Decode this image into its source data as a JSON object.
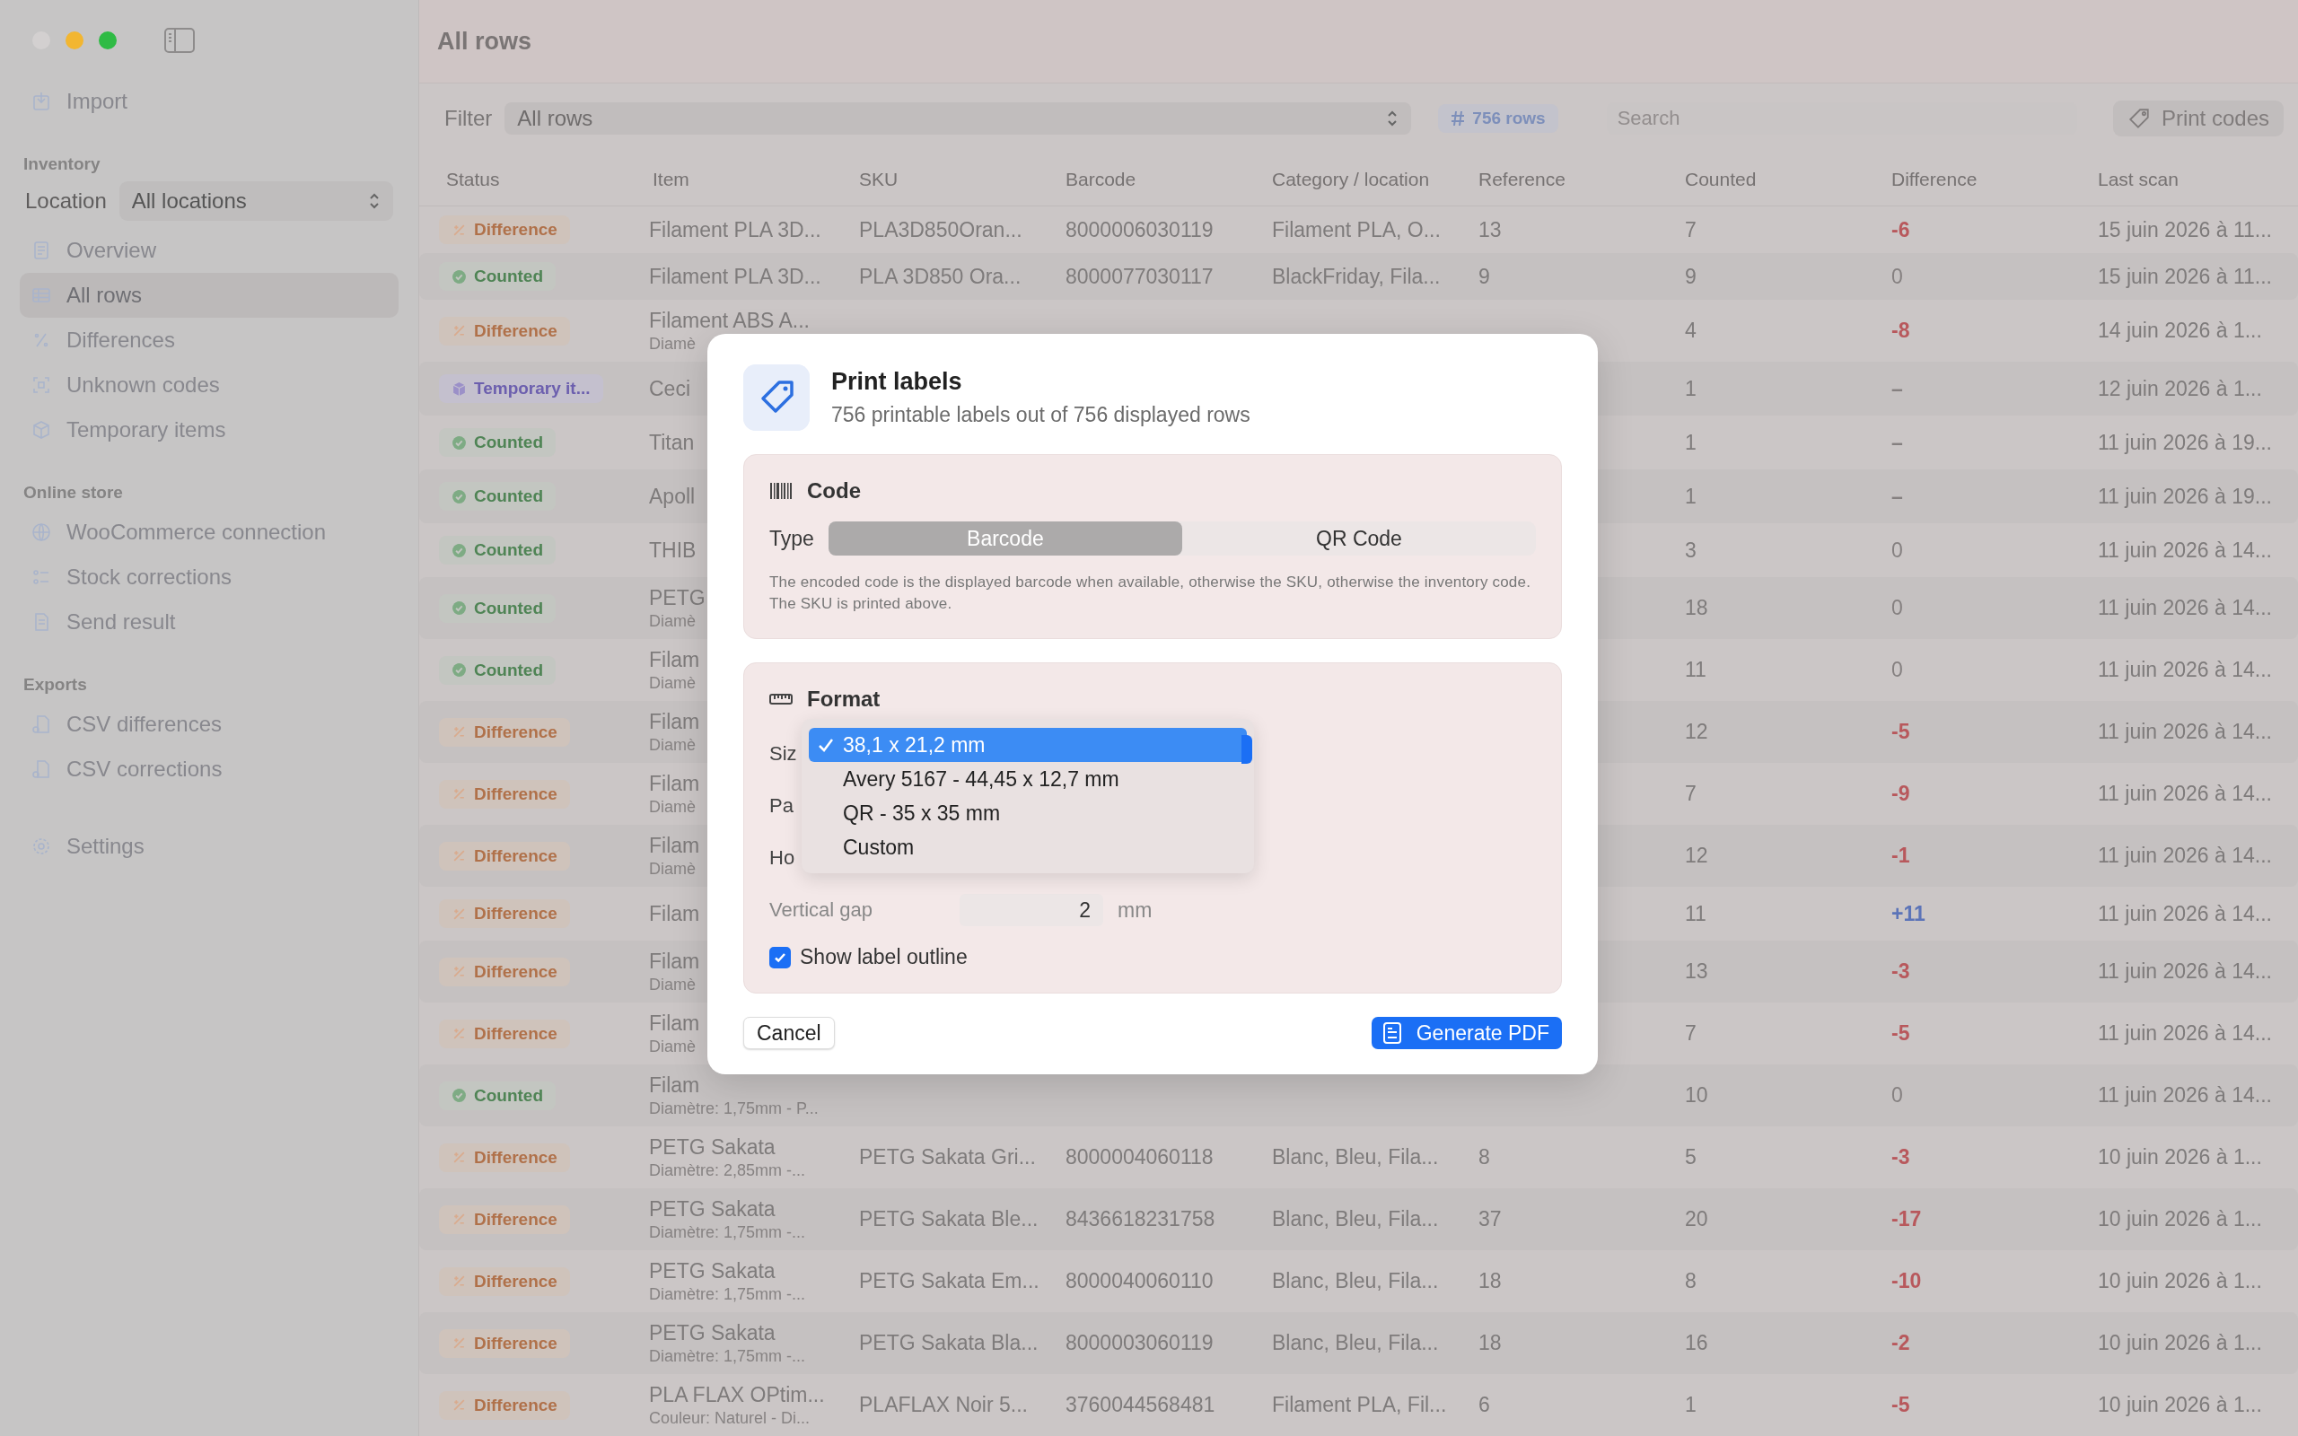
{
  "window": {
    "title": "All rows"
  },
  "sidebar": {
    "sections": [
      {
        "items": [
          {
            "label": "Import",
            "selected": false
          }
        ]
      },
      {
        "title": "Inventory",
        "location": {
          "label": "Location",
          "value": "All locations"
        },
        "items": [
          {
            "label": "Overview",
            "selected": false
          },
          {
            "label": "All rows",
            "selected": true
          },
          {
            "label": "Differences",
            "selected": false
          },
          {
            "label": "Unknown codes",
            "selected": false
          },
          {
            "label": "Temporary items",
            "selected": false
          }
        ]
      },
      {
        "title": "Online store",
        "items": [
          {
            "label": "WooCommerce connection",
            "selected": false
          },
          {
            "label": "Stock corrections",
            "selected": false
          },
          {
            "label": "Send result",
            "selected": false
          }
        ]
      },
      {
        "title": "Exports",
        "items": [
          {
            "label": "CSV differences",
            "selected": false
          },
          {
            "label": "CSV corrections",
            "selected": false
          }
        ]
      },
      {
        "items": [
          {
            "label": "Settings",
            "selected": false
          }
        ]
      }
    ]
  },
  "toolbar": {
    "filter_label": "Filter",
    "filter_value": "All rows",
    "row_count": "756 rows",
    "search": {
      "placeholder": "Search"
    },
    "print_button": "Print codes"
  },
  "table": {
    "columns": [
      "Status",
      "Item",
      "SKU",
      "Barcode",
      "Category / location",
      "Reference",
      "Counted",
      "Difference",
      "Last scan"
    ],
    "rows": [
      {
        "status": {
          "kind": "difference",
          "label": "Difference"
        },
        "item": "Filament PLA 3D...",
        "sku": "PLA3D850Oran...",
        "barcode": "8000006030119",
        "category": "Filament PLA, O...",
        "reference": "13",
        "counted": "7",
        "difference": {
          "kind": "negative",
          "value": "-6"
        },
        "last_scan": "15 juin 2026 à 11..."
      },
      {
        "status": {
          "kind": "counted",
          "label": "Counted"
        },
        "item": "Filament PLA 3D...",
        "sku": "PLA 3D850 Ora...",
        "barcode": "8000077030117",
        "category": "BlackFriday, Fila...",
        "reference": "9",
        "counted": "9",
        "difference": {
          "kind": "zero",
          "value": "0"
        },
        "last_scan": "15 juin 2026 à 11..."
      },
      {
        "status": {
          "kind": "difference",
          "label": "Difference"
        },
        "item": "Filament ABS A...",
        "subtitle": "Diamè",
        "counted": "4",
        "difference": {
          "kind": "negative",
          "value": "-8"
        },
        "last_scan": "14 juin 2026 à 1..."
      },
      {
        "status": {
          "kind": "temporary",
          "label": "Temporary it..."
        },
        "item": "Ceci",
        "counted": "1",
        "difference": {
          "kind": "none",
          "value": "–"
        },
        "last_scan": "12 juin 2026 à 1..."
      },
      {
        "status": {
          "kind": "counted",
          "label": "Counted"
        },
        "item": "Titan",
        "counted": "1",
        "difference": {
          "kind": "none",
          "value": "–"
        },
        "last_scan": "11 juin 2026 à 19..."
      },
      {
        "status": {
          "kind": "counted",
          "label": "Counted"
        },
        "item": "Apoll",
        "counted": "1",
        "difference": {
          "kind": "none",
          "value": "–"
        },
        "last_scan": "11 juin 2026 à 19..."
      },
      {
        "status": {
          "kind": "counted",
          "label": "Counted"
        },
        "item": "THIB",
        "counted": "3",
        "difference": {
          "kind": "zero",
          "value": "0"
        },
        "last_scan": "11 juin 2026 à 14..."
      },
      {
        "status": {
          "kind": "counted",
          "label": "Counted"
        },
        "item": "PETG",
        "subtitle": "Diamè",
        "counted": "18",
        "difference": {
          "kind": "zero",
          "value": "0"
        },
        "last_scan": "11 juin 2026 à 14..."
      },
      {
        "status": {
          "kind": "counted",
          "label": "Counted"
        },
        "item": "Filam",
        "subtitle": "Diamè",
        "counted": "11",
        "difference": {
          "kind": "zero",
          "value": "0"
        },
        "last_scan": "11 juin 2026 à 14..."
      },
      {
        "status": {
          "kind": "difference",
          "label": "Difference"
        },
        "item": "Filam",
        "subtitle": "Diamè",
        "counted": "12",
        "difference": {
          "kind": "negative",
          "value": "-5"
        },
        "last_scan": "11 juin 2026 à 14..."
      },
      {
        "status": {
          "kind": "difference",
          "label": "Difference"
        },
        "item": "Filam",
        "subtitle": "Diamè",
        "counted": "7",
        "difference": {
          "kind": "negative",
          "value": "-9"
        },
        "last_scan": "11 juin 2026 à 14..."
      },
      {
        "status": {
          "kind": "difference",
          "label": "Difference"
        },
        "item": "Filam",
        "subtitle": "Diamè",
        "counted": "12",
        "difference": {
          "kind": "negative",
          "value": "-1"
        },
        "last_scan": "11 juin 2026 à 14..."
      },
      {
        "status": {
          "kind": "difference",
          "label": "Difference"
        },
        "item": "Filam",
        "counted": "11",
        "difference": {
          "kind": "positive",
          "value": "+11"
        },
        "last_scan": "11 juin 2026 à 14..."
      },
      {
        "status": {
          "kind": "difference",
          "label": "Difference"
        },
        "item": "Filam",
        "subtitle": "Diamè",
        "counted": "13",
        "difference": {
          "kind": "negative",
          "value": "-3"
        },
        "last_scan": "11 juin 2026 à 14..."
      },
      {
        "status": {
          "kind": "difference",
          "label": "Difference"
        },
        "item": "Filam",
        "subtitle": "Diamè",
        "counted": "7",
        "difference": {
          "kind": "negative",
          "value": "-5"
        },
        "last_scan": "11 juin 2026 à 14..."
      },
      {
        "status": {
          "kind": "counted",
          "label": "Counted"
        },
        "item": "Filam",
        "subtitle": "Diamètre: 1,75mm - P...",
        "counted": "10",
        "difference": {
          "kind": "zero",
          "value": "0"
        },
        "last_scan": "11 juin 2026 à 14..."
      },
      {
        "status": {
          "kind": "difference",
          "label": "Difference"
        },
        "item": "PETG Sakata",
        "subtitle": "Diamètre: 2,85mm -...",
        "sku": "PETG Sakata Gri...",
        "barcode": "8000004060118",
        "category": "Blanc, Bleu, Fila...",
        "reference": "8",
        "counted": "5",
        "difference": {
          "kind": "negative",
          "value": "-3"
        },
        "last_scan": "10 juin 2026 à 1..."
      },
      {
        "status": {
          "kind": "difference",
          "label": "Difference"
        },
        "item": "PETG Sakata",
        "subtitle": "Diamètre: 1,75mm -...",
        "sku": "PETG Sakata Ble...",
        "barcode": "8436618231758",
        "category": "Blanc, Bleu, Fila...",
        "reference": "37",
        "counted": "20",
        "difference": {
          "kind": "negative",
          "value": "-17"
        },
        "last_scan": "10 juin 2026 à 1..."
      },
      {
        "status": {
          "kind": "difference",
          "label": "Difference"
        },
        "item": "PETG Sakata",
        "subtitle": "Diamètre: 1,75mm -...",
        "sku": "PETG Sakata Em...",
        "barcode": "8000040060110",
        "category": "Blanc, Bleu, Fila...",
        "reference": "18",
        "counted": "8",
        "difference": {
          "kind": "negative",
          "value": "-10"
        },
        "last_scan": "10 juin 2026 à 1..."
      },
      {
        "status": {
          "kind": "difference",
          "label": "Difference"
        },
        "item": "PETG Sakata",
        "subtitle": "Diamètre: 1,75mm -...",
        "sku": "PETG Sakata Bla...",
        "barcode": "8000003060119",
        "category": "Blanc, Bleu, Fila...",
        "reference": "18",
        "counted": "16",
        "difference": {
          "kind": "negative",
          "value": "-2"
        },
        "last_scan": "10 juin 2026 à 1..."
      },
      {
        "status": {
          "kind": "difference",
          "label": "Difference"
        },
        "item": "PLA FLAX OPtim...",
        "subtitle": "Couleur: Naturel - Di...",
        "sku": "PLAFLAX Noir 5...",
        "barcode": "3760044568481",
        "category": "Filament PLA, Fil...",
        "reference": "6",
        "counted": "1",
        "difference": {
          "kind": "negative",
          "value": "-5"
        },
        "last_scan": "10 juin 2026 à 1..."
      }
    ]
  },
  "dialog": {
    "title": "Print labels",
    "subtitle": "756 printable labels out of 756 displayed rows",
    "code_section": {
      "title": "Code",
      "type_label": "Type",
      "options": [
        {
          "label": "Barcode",
          "selected": true
        },
        {
          "label": "QR Code",
          "selected": false
        }
      ],
      "note": "The encoded code is the displayed barcode when available, otherwise the SKU, otherwise the inventory code. The SKU is printed above."
    },
    "format_section": {
      "title": "Format",
      "fields": [
        {
          "label": "Siz"
        },
        {
          "label": "Pa"
        },
        {
          "label": "Ho"
        },
        {
          "label": "Vertical gap",
          "value": "2",
          "unit": "mm"
        }
      ],
      "show_outline": {
        "label": "Show label outline",
        "checked": true
      },
      "size_menu": [
        {
          "label": "38,1 x 21,2 mm",
          "selected": true
        },
        {
          "label": "Avery 5167 - 44,45 x 12,7 mm",
          "selected": false
        },
        {
          "label": "QR - 35 x 35 mm",
          "selected": false
        },
        {
          "label": "Custom",
          "selected": false
        }
      ]
    },
    "cancel_button": "Cancel",
    "generate_button": "Generate PDF"
  }
}
